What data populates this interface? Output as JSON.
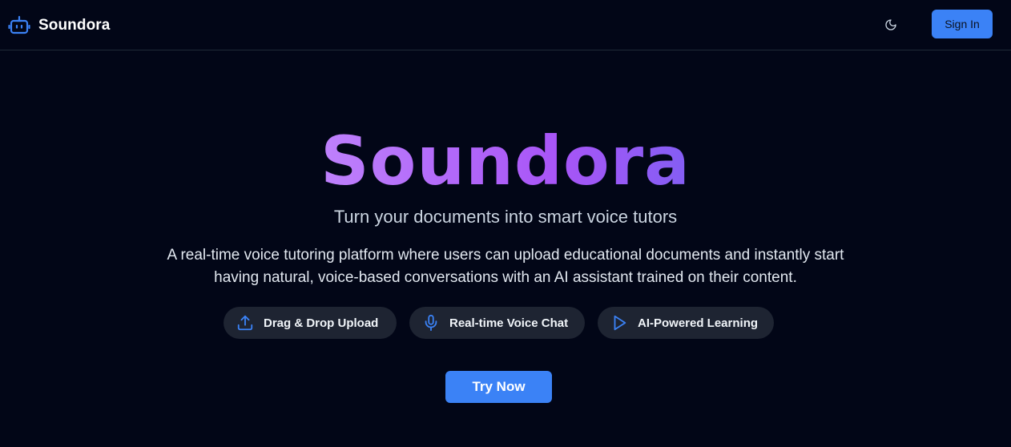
{
  "nav": {
    "brand_name": "Soundora",
    "brand_icon": "robot-icon",
    "theme_icon": "moon-icon",
    "signin_label": "Sign In"
  },
  "hero": {
    "title": "Soundora",
    "subtitle": "Turn your documents into smart voice tutors",
    "description": "A real-time voice tutoring platform where users can upload educational documents and instantly start having natural, voice-based conversations with an AI assistant trained on their content.",
    "features": [
      {
        "label": "Drag & Drop Upload",
        "icon": "upload-icon"
      },
      {
        "label": "Real-time Voice Chat",
        "icon": "microphone-icon"
      },
      {
        "label": "AI-Powered Learning",
        "icon": "play-icon"
      }
    ],
    "cta_label": "Try Now"
  },
  "colors": {
    "background": "#020617",
    "accent": "#3b82f6",
    "pill_background": "#1e2432"
  }
}
